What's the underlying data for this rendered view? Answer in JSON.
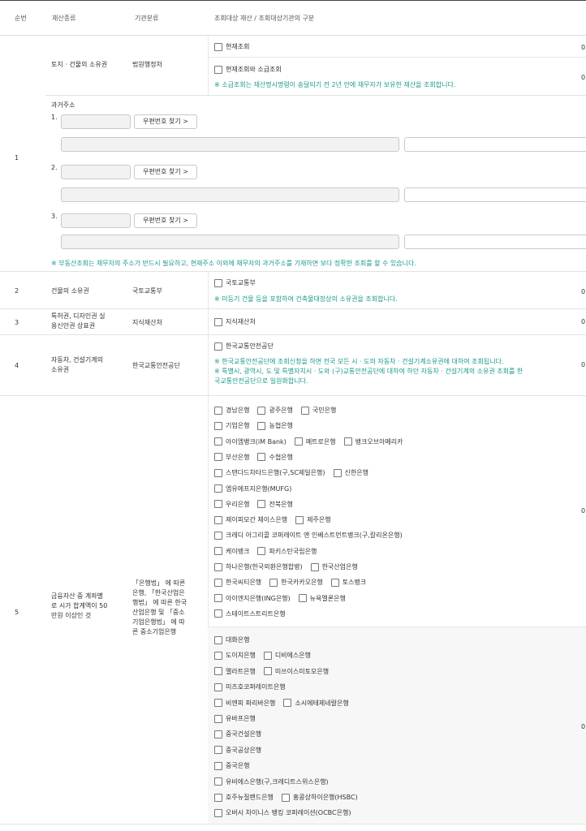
{
  "headers": {
    "num": "순번",
    "type": "재산종류",
    "org": "기관분류",
    "scope": "조회대상 재산 / 조회대상기관의 구분"
  },
  "r1": {
    "num": "1",
    "type": "토지 · 건물의 소유권",
    "org": "법원행정처",
    "opt_current": "현재조회",
    "opt_past": "현재조회와 소급조회",
    "note_past": "※ 소급조회는 재산명시명령이 송달되기 전 2년 안에 채무자가 보유한 재산을 조회합니다.",
    "past_addr_label": "과거주소",
    "idx1": "1.",
    "idx2": "2.",
    "idx3": "3.",
    "zip_btn": "우편번호 찾기 >",
    "note_addr": "※ 부동산조회는 채무자의 주소가 반드시 필요하고, 현재주소 이외에 채무자의 과거주소를 기재하면 보다 정확한 조회를 할 수 있습니다."
  },
  "r2": {
    "num": "2",
    "type": "건물의 소유권",
    "org": "국토교통부",
    "opt": "국토교통부",
    "note": "※ 미등기 건물 등을 포함하여 건축물대장상의 소유권을 조회합니다."
  },
  "r3": {
    "num": "3",
    "type1": "특허권, 디자인권 실",
    "type2": "용신안권 상표권",
    "org": "지식재산처",
    "opt": "지식재산처"
  },
  "r4": {
    "num": "4",
    "type1": "자동차, 건설기계의",
    "type2": "소유권",
    "org": "한국교통안전공단",
    "opt": "한국교통안전공단",
    "note1": "※ 한국교통안전공단에 조회신청을 하면 전국 모든 시 · 도의 자동차 · 건설기계소유권에 대하여 조회됩니다.",
    "note2": "※ 특별시, 광역시, 도 및 특별자치시 · 도와 (구)교통안전공단에 대하여 하던 자동차 · 건설기계의 소유권 조회를 한",
    "note3": "국교통안전공단으로 일원화합니다."
  },
  "r5": {
    "num": "5",
    "type1": "금융자산 중 계좌별",
    "type2": "로 시가 합계액이 50",
    "type3": "만원 이상인 것",
    "org1": "「은행법」 에 따른",
    "org2": "은행, 「한국산업은",
    "org3": "행법」 에 따른 한국",
    "org4": "산업은행 및 「중소",
    "org5": "기업은행법」 에 따",
    "org6": "른 중소기업은행",
    "banks1": [
      [
        "경남은행",
        "광주은행",
        "국민은행"
      ],
      [
        "기업은행",
        "농협은행"
      ],
      [
        "아이엠뱅크(iM Bank)",
        "메트로은행",
        "뱅크오브아메리카"
      ],
      [
        "부산은행",
        "수협은행"
      ],
      [
        "스탠다드차타드은행(구,SC제일은행)",
        "신한은행"
      ],
      [
        "엠유에프지은행(MUFG)"
      ],
      [
        "우리은행",
        "전북은행"
      ],
      [
        "제이피모간 체이스은행",
        "제주은행"
      ],
      [
        "크레디 아그리콜 코퍼레이트 앤 인베스트먼트뱅크(구,칼리온은행)"
      ],
      [
        "케이뱅크",
        "파키스탄국립은행"
      ],
      [
        "하나은행(한국외환은행합병)",
        "한국산업은행"
      ],
      [
        "한국씨티은행",
        "한국카카오은행",
        "토스뱅크"
      ],
      [
        "아이엔지은행(ING은행)",
        "뉴욕멜론은행"
      ],
      [
        "스테이트스트리트은행"
      ]
    ],
    "banks2": [
      [
        "대화은행"
      ],
      [
        "도이치은행",
        "디비에스은행"
      ],
      [
        "멜라트은행",
        "미쓰이스미토모은행"
      ],
      [
        "미즈호코퍼레이트은행"
      ],
      [
        "비엔피 파리바은행",
        "소시에테제네랄은행"
      ],
      [
        "유바프은행"
      ],
      [
        "중국건설은행"
      ],
      [
        "중국공상은행"
      ],
      [
        "중국은행"
      ],
      [
        "유비에스은행(구,크레디트스위스은행)"
      ],
      [
        "호주뉴질랜드은행",
        "홍콩상하이은행(HSBC)"
      ],
      [
        "오버시 차이니스 뱅킹 코퍼레이션(OCBC은행)"
      ]
    ]
  },
  "zero": "0"
}
